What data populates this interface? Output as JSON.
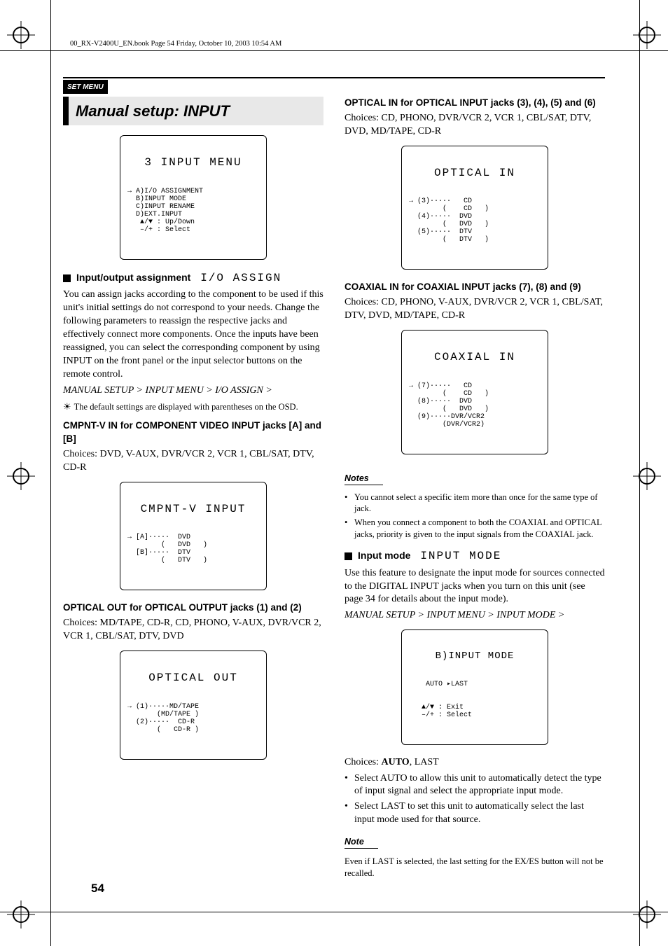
{
  "meta": {
    "header_line": "00_RX-V2400U_EN.book  Page 54  Friday, October 10, 2003  10:54 AM"
  },
  "section_bar": "SET MENU",
  "page_number": "54",
  "left": {
    "title": "Manual setup: INPUT",
    "osd1": {
      "title": "3 INPUT MENU",
      "body": "→ A)I/O ASSIGNMENT\n  B)INPUT MODE\n  C)INPUT RENAME\n  D)EXT.INPUT\n   ▲/▼ : Up/Down\n   –/+ : Select"
    },
    "io_assign": {
      "heading": "Input/output assignment",
      "mono": "I/O ASSIGN",
      "para": "You can assign jacks according to the component to be used if this unit's initial settings do not correspond to your needs. Change the following parameters to reassign the respective jacks and effectively connect more components. Once the inputs have been reassigned, you can select the corresponding component by using INPUT on the front panel or the input selector buttons on the remote control.",
      "path": "MANUAL SETUP > INPUT MENU > I/O ASSIGN >",
      "tip": "The default settings are displayed with parentheses on the OSD."
    },
    "cmpnt": {
      "heading": "CMPNT-V IN for COMPONENT VIDEO INPUT jacks [A] and [B]",
      "choices": "Choices: DVD, V-AUX, DVR/VCR 2, VCR 1, CBL/SAT, DTV, CD-R",
      "osd_title": "CMPNT-V INPUT",
      "osd_body": "→ [A]·····  DVD\n        (   DVD   )\n  [B]·····  DTV\n        (   DTV   )"
    },
    "optical_out": {
      "heading": "OPTICAL OUT for OPTICAL OUTPUT jacks (1) and (2)",
      "choices": "Choices: MD/TAPE, CD-R, CD, PHONO, V-AUX, DVR/VCR 2, VCR 1, CBL/SAT, DTV, DVD",
      "osd_title": "OPTICAL OUT",
      "osd_body": "→ (1)·····MD/TAPE\n       (MD/TAPE )\n  (2)·····  CD-R\n       (   CD-R )"
    }
  },
  "right": {
    "optical_in": {
      "heading": "OPTICAL IN for OPTICAL INPUT jacks (3), (4), (5) and (6)",
      "choices": "Choices: CD, PHONO, DVR/VCR 2, VCR 1, CBL/SAT, DTV, DVD, MD/TAPE, CD-R",
      "osd_title": "OPTICAL IN",
      "osd_body": "→ (3)·····   CD\n        (    CD   )\n  (4)·····  DVD\n        (   DVD   )\n  (5)·····  DTV\n        (   DTV   )"
    },
    "coaxial_in": {
      "heading": "COAXIAL IN for COAXIAL INPUT jacks (7), (8) and (9)",
      "choices": "Choices: CD, PHONO, V-AUX, DVR/VCR 2, VCR 1, CBL/SAT, DTV, DVD, MD/TAPE, CD-R",
      "osd_title": "COAXIAL IN",
      "osd_body": "→ (7)·····   CD\n        (    CD   )\n  (8)·····  DVD\n        (   DVD   )\n  (9)·····DVR/VCR2\n        (DVR/VCR2)"
    },
    "notes_label": "Notes",
    "notes": [
      "You cannot select a specific item more than once for the same type of jack.",
      "When you connect a component to both the COAXIAL and OPTICAL jacks, priority is given to the input signals from the COAXIAL jack."
    ],
    "input_mode": {
      "heading": "Input mode",
      "mono": "INPUT MODE",
      "para": "Use this feature to designate the input mode for sources connected to the DIGITAL INPUT jacks when you turn on this unit (see page 34 for details about the input mode).",
      "path": "MANUAL SETUP > INPUT MENU > INPUT MODE >",
      "osd_title": "B)INPUT MODE",
      "osd_body": "    AUTO ▸LAST\n\n\n   ▲/▼ : Exit\n   –/+ : Select",
      "choices_label": "Choices: ",
      "choices_bold": "AUTO",
      "choices_rest": ", LAST",
      "bullets": [
        "Select AUTO to allow this unit to automatically detect the type of input signal and select the appropriate input mode.",
        "Select LAST to set this unit to automatically select the last input mode used for that source."
      ],
      "note_label": "Note",
      "note_text": "Even if LAST is selected, the last setting for the EX/ES button will not be recalled."
    }
  }
}
